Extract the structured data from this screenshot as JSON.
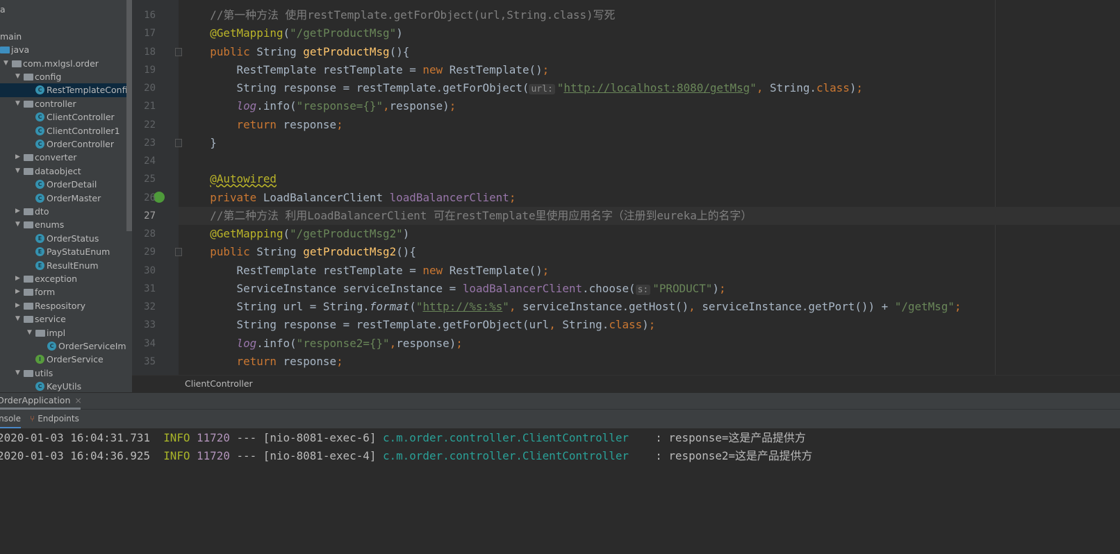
{
  "tree": [
    {
      "label": "a",
      "depth": -1
    },
    {
      "label": "",
      "depth": -1
    },
    {
      "label": "main",
      "depth": -1
    },
    {
      "label": "java",
      "depth": 0,
      "icon": "folder-src"
    },
    {
      "label": "com.mxlgsl.order",
      "depth": 1,
      "icon": "folder",
      "arrow": "open"
    },
    {
      "label": "config",
      "depth": 2,
      "icon": "folder",
      "arrow": "open"
    },
    {
      "label": "RestTemplateConfig",
      "depth": 3,
      "icon": "class",
      "selected": true
    },
    {
      "label": "controller",
      "depth": 2,
      "icon": "folder",
      "arrow": "open"
    },
    {
      "label": "ClientController",
      "depth": 3,
      "icon": "class"
    },
    {
      "label": "ClientController1",
      "depth": 3,
      "icon": "class"
    },
    {
      "label": "OrderController",
      "depth": 3,
      "icon": "class"
    },
    {
      "label": "converter",
      "depth": 2,
      "icon": "folder",
      "arrow": "closed"
    },
    {
      "label": "dataobject",
      "depth": 2,
      "icon": "folder",
      "arrow": "open"
    },
    {
      "label": "OrderDetail",
      "depth": 3,
      "icon": "class"
    },
    {
      "label": "OrderMaster",
      "depth": 3,
      "icon": "class"
    },
    {
      "label": "dto",
      "depth": 2,
      "icon": "folder",
      "arrow": "closed"
    },
    {
      "label": "enums",
      "depth": 2,
      "icon": "folder",
      "arrow": "open"
    },
    {
      "label": "OrderStatus",
      "depth": 3,
      "icon": "enum"
    },
    {
      "label": "PayStatuEnum",
      "depth": 3,
      "icon": "enum"
    },
    {
      "label": "ResultEnum",
      "depth": 3,
      "icon": "enum"
    },
    {
      "label": "exception",
      "depth": 2,
      "icon": "folder",
      "arrow": "closed"
    },
    {
      "label": "form",
      "depth": 2,
      "icon": "folder",
      "arrow": "closed"
    },
    {
      "label": "Respository",
      "depth": 2,
      "icon": "folder",
      "arrow": "closed"
    },
    {
      "label": "service",
      "depth": 2,
      "icon": "folder",
      "arrow": "open"
    },
    {
      "label": "impl",
      "depth": 3,
      "icon": "folder",
      "arrow": "open"
    },
    {
      "label": "OrderServiceImpl",
      "depth": 4,
      "icon": "class"
    },
    {
      "label": "OrderService",
      "depth": 3,
      "icon": "interface"
    },
    {
      "label": "utils",
      "depth": 2,
      "icon": "folder",
      "arrow": "open"
    },
    {
      "label": "KeyUtils",
      "depth": 3,
      "icon": "class"
    }
  ],
  "editor": {
    "current_line": 27,
    "lines": [
      {
        "n": 16,
        "t": [
          [
            "cm",
            "    //第一种方法 使用restTemplate.getForObject(url,String.class)写死"
          ]
        ]
      },
      {
        "n": 17,
        "t": [
          [
            "",
            "    "
          ],
          [
            "an",
            "@GetMapping"
          ],
          [
            "",
            "("
          ],
          [
            "str",
            "\"/getProductMsg\""
          ],
          [
            "",
            ")"
          ]
        ]
      },
      {
        "n": 18,
        "t": [
          [
            "",
            "    "
          ],
          [
            "kw",
            "public "
          ],
          [
            "",
            "String "
          ],
          [
            "fn",
            "getProductMsg"
          ],
          [
            "",
            "(){"
          ]
        ]
      },
      {
        "n": 19,
        "t": [
          [
            "",
            "        RestTemplate restTemplate = "
          ],
          [
            "kw",
            "new "
          ],
          [
            "",
            "RestTemplate()"
          ],
          [
            "kw",
            ";"
          ]
        ]
      },
      {
        "n": 20,
        "t": [
          [
            "",
            "        String response = restTemplate.getForObject("
          ],
          [
            "hint",
            "url:"
          ],
          [
            "str",
            "\""
          ],
          [
            "url",
            "http://localhost:8080/getMsg"
          ],
          [
            "str",
            "\""
          ],
          [
            "kw",
            ", "
          ],
          [
            "",
            "String."
          ],
          [
            "kw",
            "class"
          ],
          [
            "",
            ")"
          ],
          [
            "kw",
            ";"
          ]
        ]
      },
      {
        "n": 21,
        "t": [
          [
            "",
            "        "
          ],
          [
            "it",
            "log"
          ],
          [
            "",
            ".info("
          ],
          [
            "str",
            "\"response={}\""
          ],
          [
            "kw",
            ","
          ],
          [
            "",
            "response)"
          ],
          [
            "kw",
            ";"
          ]
        ]
      },
      {
        "n": 22,
        "t": [
          [
            "",
            "        "
          ],
          [
            "kw",
            "return "
          ],
          [
            "",
            "response"
          ],
          [
            "kw",
            ";"
          ]
        ]
      },
      {
        "n": 23,
        "t": [
          [
            "",
            "    }"
          ]
        ]
      },
      {
        "n": 24,
        "t": []
      },
      {
        "n": 25,
        "t": [
          [
            "",
            "    "
          ],
          [
            "an wavy",
            "@Autowired"
          ]
        ]
      },
      {
        "n": 26,
        "t": [
          [
            "",
            "    "
          ],
          [
            "kw",
            "private "
          ],
          [
            "",
            "LoadBalancerClient "
          ],
          [
            "fld",
            "loadBalancerClient"
          ],
          [
            "kw",
            ";"
          ]
        ]
      },
      {
        "n": 27,
        "t": [
          [
            "cm",
            "    //第二种方法 利用LoadBalancerClient 可在restTemplate里使用应用名字（注册到eureka上的名字）"
          ]
        ]
      },
      {
        "n": 28,
        "t": [
          [
            "",
            "    "
          ],
          [
            "an",
            "@GetMapping"
          ],
          [
            "",
            "("
          ],
          [
            "str",
            "\"/getProductMsg2\""
          ],
          [
            "",
            ")"
          ]
        ]
      },
      {
        "n": 29,
        "t": [
          [
            "",
            "    "
          ],
          [
            "kw",
            "public "
          ],
          [
            "",
            "String "
          ],
          [
            "fn",
            "getProductMsg2"
          ],
          [
            "",
            "(){"
          ]
        ]
      },
      {
        "n": 30,
        "t": [
          [
            "",
            "        RestTemplate restTemplate = "
          ],
          [
            "kw",
            "new "
          ],
          [
            "",
            "RestTemplate()"
          ],
          [
            "kw",
            ";"
          ]
        ]
      },
      {
        "n": 31,
        "t": [
          [
            "",
            "        ServiceInstance serviceInstance = "
          ],
          [
            "fld",
            "loadBalancerClient"
          ],
          [
            "",
            ".choose("
          ],
          [
            "hint",
            "s:"
          ],
          [
            "str",
            "\"PRODUCT\""
          ],
          [
            "",
            ")"
          ],
          [
            "kw",
            ";"
          ]
        ]
      },
      {
        "n": 32,
        "t": [
          [
            "",
            "        String url = String."
          ],
          [
            "itf",
            "format"
          ],
          [
            "",
            "("
          ],
          [
            "str",
            "\""
          ],
          [
            "url",
            "http://%s:%s"
          ],
          [
            "str",
            "\""
          ],
          [
            "kw",
            ", "
          ],
          [
            "",
            "serviceInstance.getHost()"
          ],
          [
            "kw",
            ", "
          ],
          [
            "",
            "serviceInstance.getPort()) + "
          ],
          [
            "str",
            "\"/getMsg\""
          ],
          [
            "kw",
            ";"
          ]
        ]
      },
      {
        "n": 33,
        "t": [
          [
            "",
            "        String response = restTemplate.getForObject(url"
          ],
          [
            "kw",
            ", "
          ],
          [
            "",
            "String."
          ],
          [
            "kw",
            "class"
          ],
          [
            "",
            ")"
          ],
          [
            "kw",
            ";"
          ]
        ]
      },
      {
        "n": 34,
        "t": [
          [
            "",
            "        "
          ],
          [
            "it",
            "log"
          ],
          [
            "",
            ".info("
          ],
          [
            "str",
            "\"response2={}\""
          ],
          [
            "kw",
            ","
          ],
          [
            "",
            "response)"
          ],
          [
            "kw",
            ";"
          ]
        ]
      },
      {
        "n": 35,
        "t": [
          [
            "",
            "        "
          ],
          [
            "kw",
            "return "
          ],
          [
            "",
            "response"
          ],
          [
            "kw",
            ";"
          ]
        ]
      }
    ]
  },
  "breadcrumb": "ClientController",
  "run_panel": {
    "tab": "OrderApplication",
    "close": "×",
    "tabs": [
      "Console",
      "Endpoints"
    ]
  },
  "console": [
    {
      "time": "2020-01-03 16:04:31.731",
      "level": "INFO",
      "pid": "11720",
      "sep": "---",
      "thread": "[nio-8081-exec-6]",
      "logger": "c.m.order.controller.ClientController",
      "msg": ": response=这是产品提供方"
    },
    {
      "time": "2020-01-03 16:04:36.925",
      "level": "INFO",
      "pid": "11720",
      "sep": "---",
      "thread": "[nio-8081-exec-4]",
      "logger": "c.m.order.controller.ClientController",
      "msg": ": response2=这是产品提供方"
    }
  ]
}
